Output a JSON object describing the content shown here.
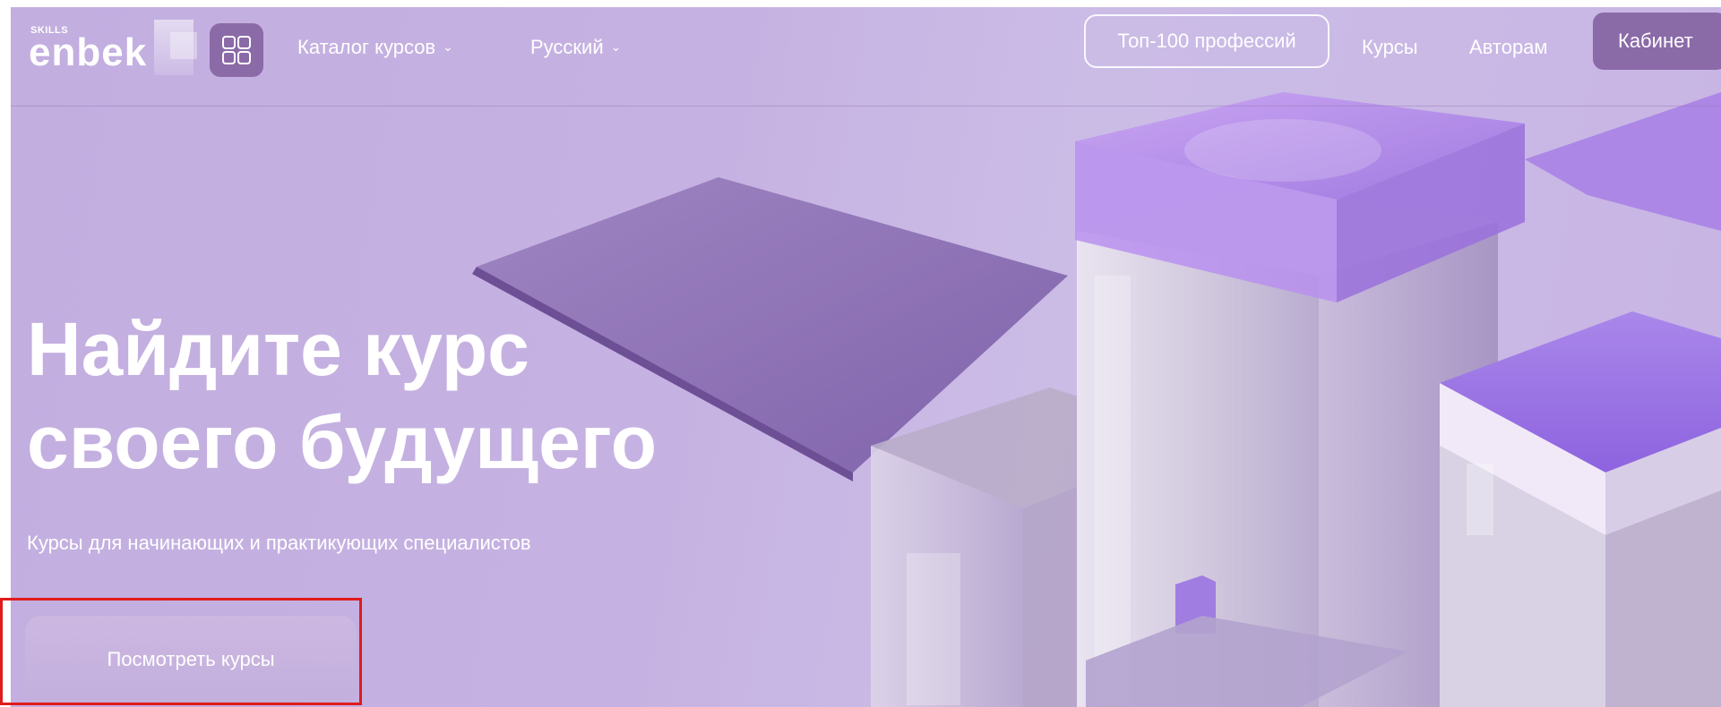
{
  "header": {
    "logo_small": "SKILLS",
    "logo_main": "enbek",
    "apps_icon": "grid-icon",
    "catalog_label": "Каталог курсов",
    "language_label": "Русский",
    "chevron_icon": "chevron-down-icon",
    "top100_label": "Топ-100 профессий",
    "courses_label": "Курсы",
    "authors_label": "Авторам",
    "cabinet_label": "Кабинет"
  },
  "hero": {
    "title_line1": "Найдите курс",
    "title_line2": "своего будущего",
    "subtitle": "Курсы для начинающих и практикующих специалистов",
    "cta_label": "Посмотреть курсы"
  },
  "colors": {
    "background": "#c4b0e0",
    "accent": "#8b6aa8",
    "highlight": "#e01b1b",
    "text": "#ffffff"
  }
}
